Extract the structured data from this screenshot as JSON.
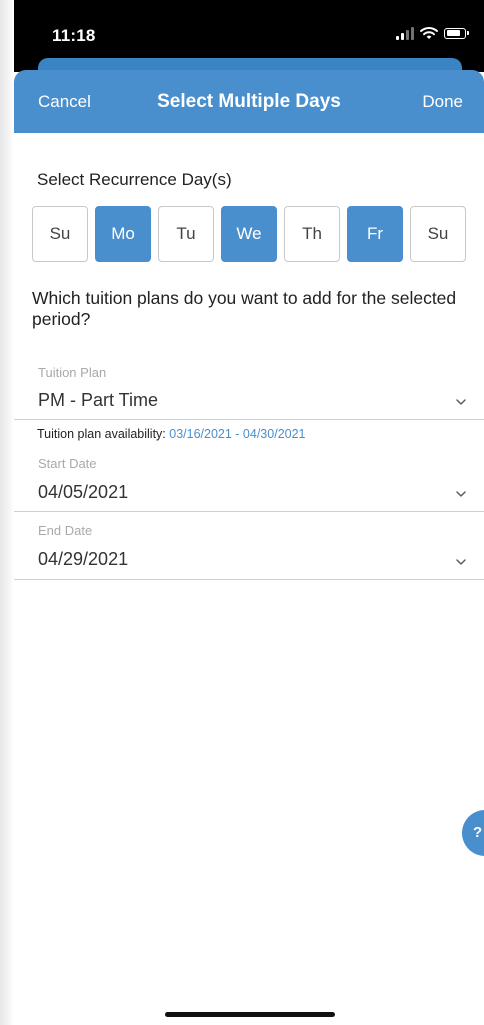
{
  "status_bar": {
    "time": "11:18"
  },
  "nav": {
    "cancel_label": "Cancel",
    "title": "Select Multiple Days",
    "done_label": "Done"
  },
  "recurrence": {
    "label": "Select Recurrence Day(s)",
    "days": [
      {
        "label": "Su",
        "selected": false
      },
      {
        "label": "Mo",
        "selected": true
      },
      {
        "label": "Tu",
        "selected": false
      },
      {
        "label": "We",
        "selected": true
      },
      {
        "label": "Th",
        "selected": false
      },
      {
        "label": "Fr",
        "selected": true
      },
      {
        "label": "Su",
        "selected": false
      }
    ]
  },
  "question": "Which tuition plans do you want to add for the selected period?",
  "tuition_plan": {
    "label": "Tuition Plan",
    "value": "PM - Part Time",
    "availability_prefix": "Tuition plan availability:",
    "availability_range": "03/16/2021 - 04/30/2021"
  },
  "start_date": {
    "label": "Start Date",
    "value": "04/05/2021"
  },
  "end_date": {
    "label": "End Date",
    "value": "04/29/2021"
  },
  "help": {
    "label": "?"
  },
  "colors": {
    "accent": "#4a8fcd",
    "link": "#4a8fcd"
  },
  "icons": {
    "signal": "cellular-signal-icon",
    "wifi": "wifi-icon",
    "battery": "battery-icon",
    "chevron": "chevron-down-icon"
  }
}
